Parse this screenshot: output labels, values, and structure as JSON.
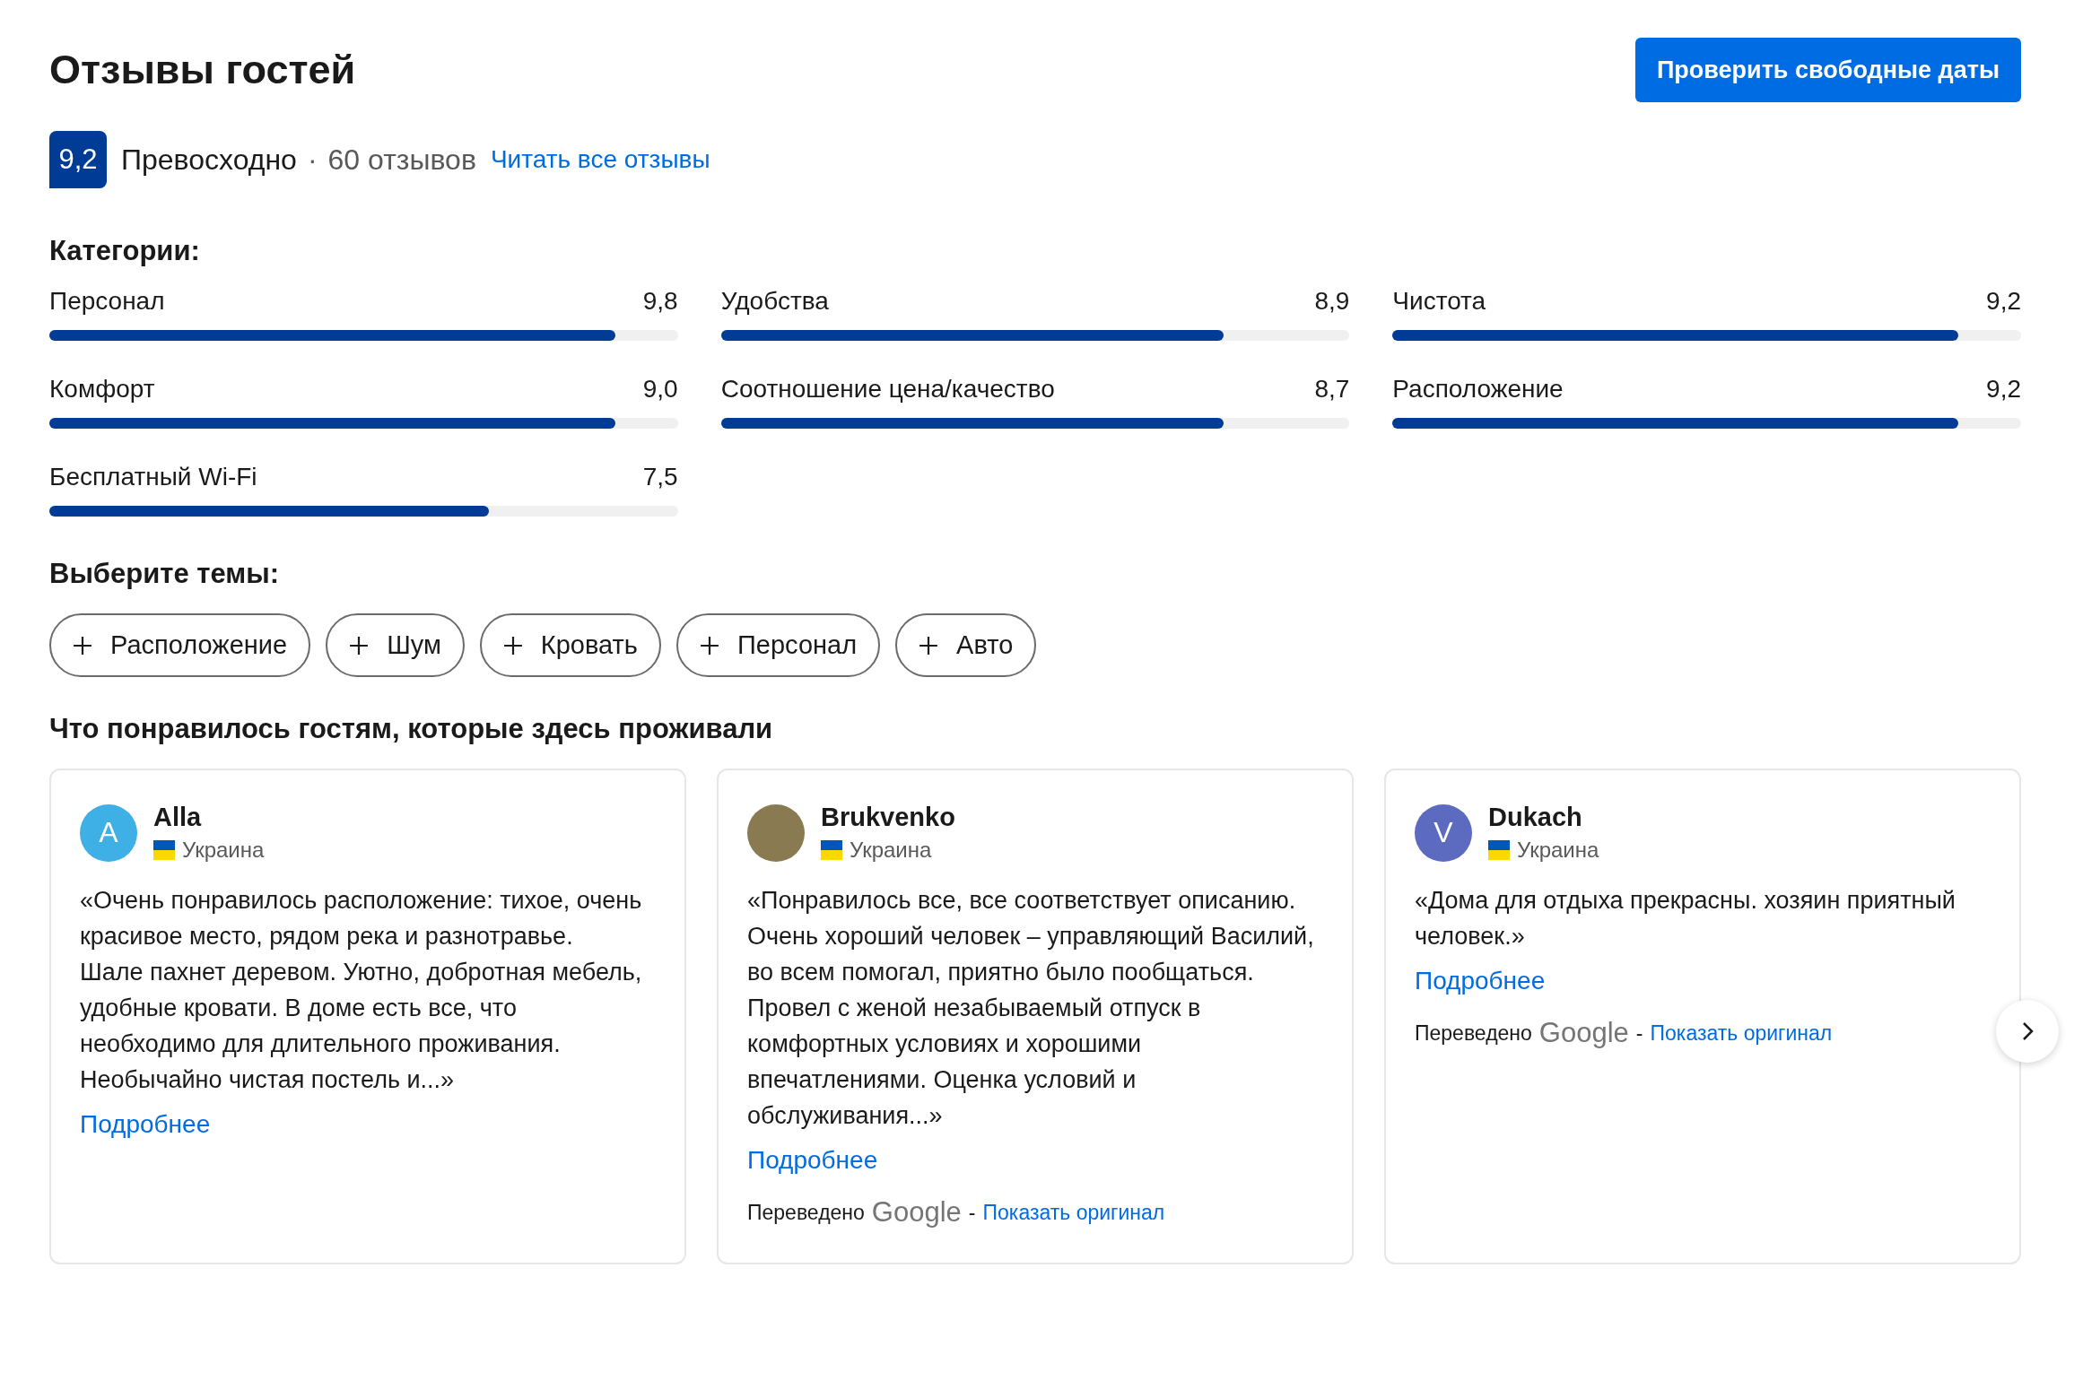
{
  "title": "Отзывы гостей",
  "action_button": "Проверить свободные даты",
  "summary": {
    "score": "9,2",
    "rating_label": "Превосходно",
    "separator": "·",
    "review_count": "60 отзывов",
    "read_all_link": "Читать все отзывы"
  },
  "categories_heading": "Категории:",
  "categories": [
    {
      "name": "Персонал",
      "score": "9,8",
      "level": 0.9
    },
    {
      "name": "Удобства",
      "score": "8,9",
      "level": 0.8
    },
    {
      "name": "Чистота",
      "score": "9,2",
      "level": 0.9
    },
    {
      "name": "Комфорт",
      "score": "9,0",
      "level": 0.9
    },
    {
      "name": "Соотношение цена/качество",
      "score": "8,7",
      "level": 0.8
    },
    {
      "name": "Расположение",
      "score": "9,2",
      "level": 0.9
    },
    {
      "name": "Бесплатный Wi-Fi",
      "score": "7,5",
      "level": 0.7
    }
  ],
  "topics_heading": "Выберите темы:",
  "topics": [
    {
      "label": "Расположение"
    },
    {
      "label": "Шум"
    },
    {
      "label": "Кровать"
    },
    {
      "label": "Персонал"
    },
    {
      "label": "Авто"
    }
  ],
  "liked_heading": "Что понравилось гостям, которые здесь проживали",
  "reviews": [
    {
      "name": "Alla",
      "avatar": {
        "kind": "letter",
        "initial": "A",
        "color": "#3fb0e6"
      },
      "country": "Украина",
      "text": "«Очень понравилось расположение: тихое, очень красивое место, рядом река и разнотравье.\nШале пахнет деревом. Уютно, добротная мебель, удобные кровати. В доме есть все, что необходимо для длительного проживания. Необычайно чистая постель и...»",
      "more_link": "Подробнее"
    },
    {
      "name": "Brukvenko",
      "avatar": {
        "kind": "photo"
      },
      "country": "Украина",
      "text": "«Понравилось все, все соответствует описанию. Очень хороший человек – управляющий Василий, во всем помогал, приятно было пообщаться. Провел с женой незабываемый отпуск в комфортных условиях и хорошими впечатлениями. Оценка условий и обслуживания...»",
      "more_link": "Подробнее",
      "translation": {
        "label": "Переведено",
        "provider": "Google",
        "separator": "-",
        "show_original": "Показать оригинал"
      }
    },
    {
      "name": "Dukach",
      "avatar": {
        "kind": "letter",
        "initial": "V",
        "color": "#5c6bc0"
      },
      "country": "Украина",
      "text": "«Дома для отдыха прекрасны. хозяин приятный человек.»",
      "more_link": "Подробнее",
      "translation": {
        "label": "Переведено",
        "provider": "Google",
        "separator": "-",
        "show_original": "Показать оригинал"
      }
    }
  ]
}
